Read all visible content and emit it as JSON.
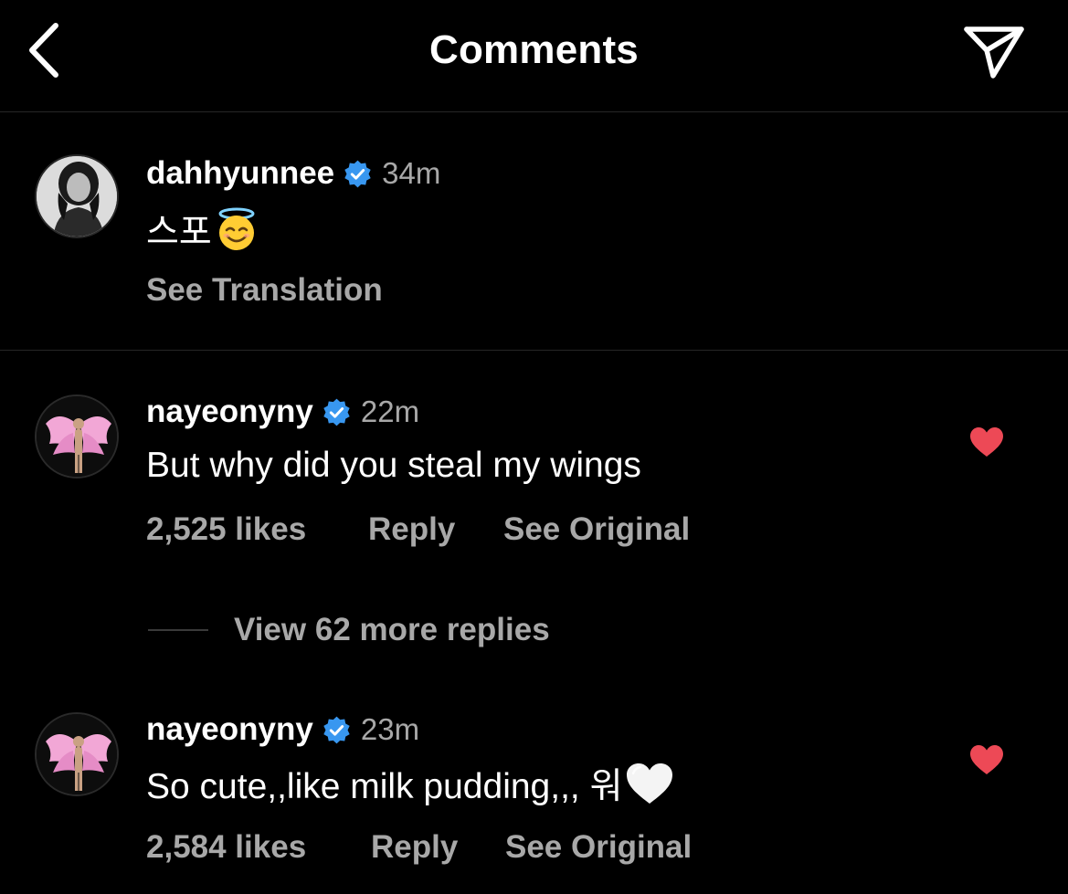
{
  "header": {
    "title": "Comments",
    "back_icon": "chevron-left-icon",
    "send_icon": "paper-plane-icon"
  },
  "caption": {
    "username": "dahhyunnee",
    "time": "34m",
    "text": "스포",
    "emoji": "smiling-face-with-halo",
    "see_translation": "See Translation"
  },
  "comments": [
    {
      "username": "nayeonyny",
      "time": "22m",
      "text": "But why did you steal my wings",
      "likes": "2,525 likes",
      "reply": "Reply",
      "see_original": "See Original",
      "liked": true
    },
    {
      "username": "nayeonyny",
      "time": "23m",
      "text": "So cute,,like milk pudding,,, 워",
      "emoji": "white-heart",
      "likes": "2,584 likes",
      "reply": "Reply",
      "see_original": "See Original",
      "liked": true
    }
  ],
  "view_replies": "View 62 more replies",
  "colors": {
    "background": "#000000",
    "text": "#ffffff",
    "secondary": "#a8a8a8",
    "verified": "#3897f0",
    "like": "#ed4956",
    "divider": "#262626"
  }
}
